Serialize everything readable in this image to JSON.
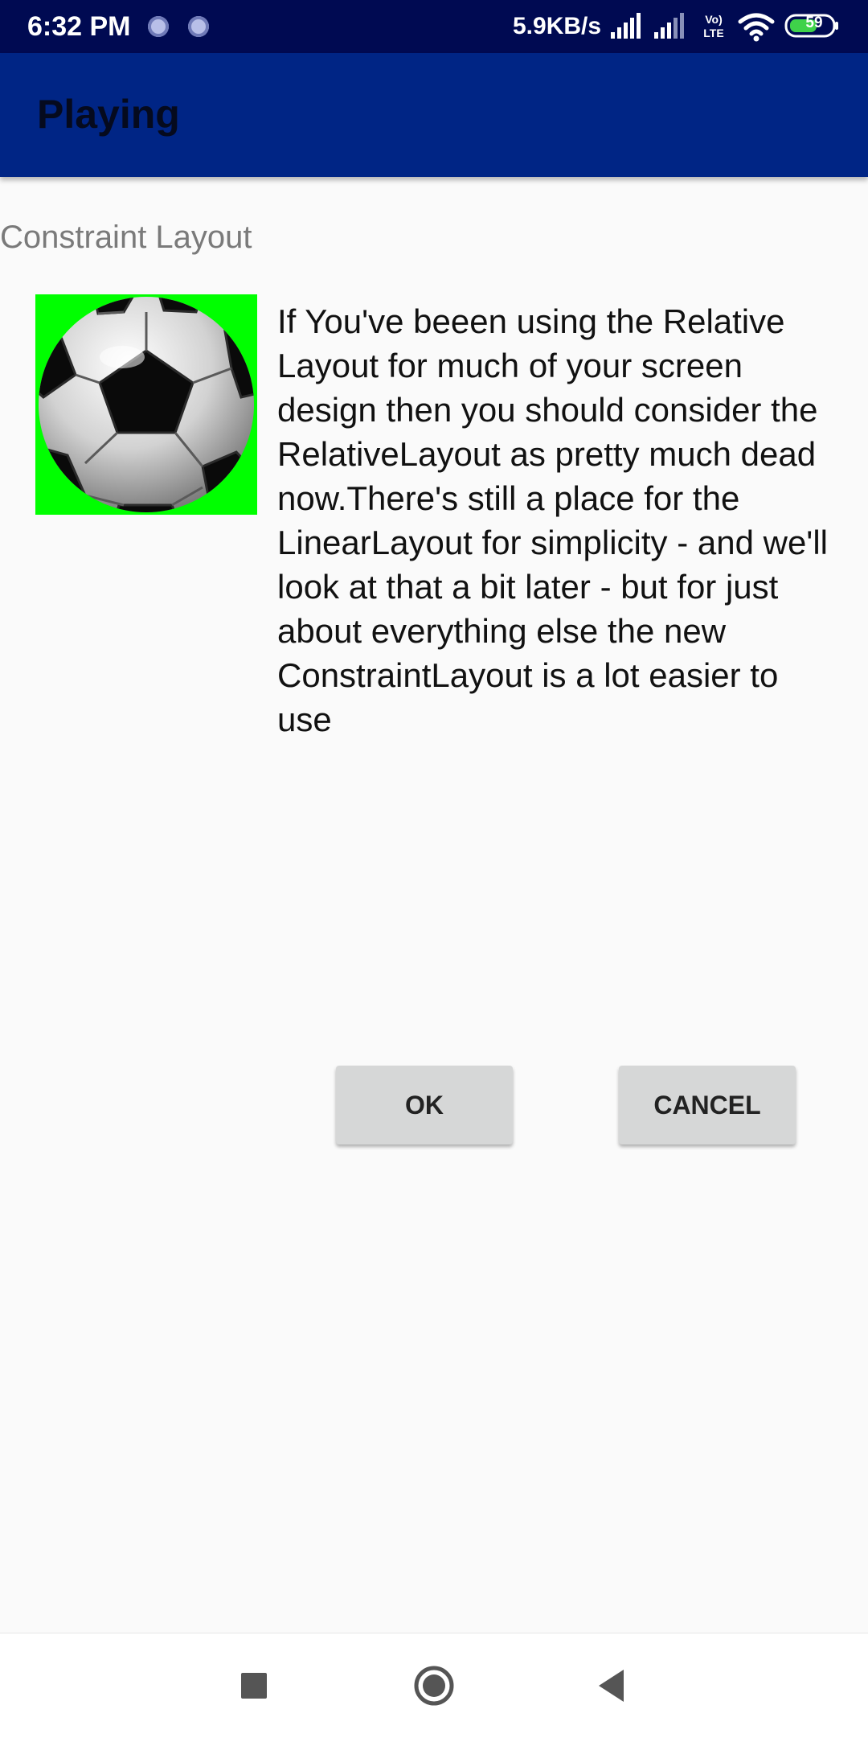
{
  "status_bar": {
    "time": "6:32 PM",
    "network_speed": "5.9KB/s",
    "network_type": "Vo) LTE",
    "battery_level": "59",
    "icons": [
      "sync-dot-icon",
      "sync-dot-icon",
      "signal-icon",
      "signal-icon",
      "volte-icon",
      "wifi-icon",
      "battery-icon"
    ]
  },
  "app_bar": {
    "title": "Playing"
  },
  "content": {
    "section_label": "Constraint Layout",
    "image": "soccer-ball-icon",
    "body_text": "If You've beeen using the Relative Layout for much of your screen design then you should consider the RelativeLayout as pretty much dead now.There's still a place for the LinearLayout for simplicity - and we'll look at that a bit later - but for just about everything else the new ConstraintLayout is a lot easier to use"
  },
  "buttons": {
    "ok_label": "OK",
    "cancel_label": "CANCEL"
  },
  "nav_bar": {
    "icons": [
      "recents-square-icon",
      "home-circle-icon",
      "back-triangle-icon"
    ]
  },
  "colors": {
    "status_bar": "#000a52",
    "app_bar": "#002585",
    "image_background": "#00ff00",
    "button": "#d6d7d7",
    "background": "#fafafa"
  }
}
